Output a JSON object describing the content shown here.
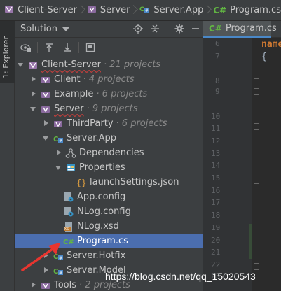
{
  "breadcrumb": [
    {
      "label": "Client-Server",
      "icon": "solution-icon"
    },
    {
      "label": "Server",
      "icon": "solution-folder-icon"
    },
    {
      "label": "Server.App",
      "icon": "project-icon"
    },
    {
      "label": "Program.cs",
      "icon": "csharp-file-icon",
      "prefix": "C#"
    }
  ],
  "side_strip": {
    "label": "1: Explorer"
  },
  "solution_header": {
    "title": "Solution"
  },
  "tree": {
    "rows": [
      {
        "label": "Client-Server",
        "sub": "· 21 projects",
        "icon": "solution-icon",
        "arrow": "down",
        "level": 0,
        "squiggle": true
      },
      {
        "label": "Client",
        "sub": "· 4 projects",
        "icon": "solution-folder-icon",
        "arrow": "right",
        "level": 1
      },
      {
        "label": "Example",
        "sub": "· 6 projects",
        "icon": "solution-folder-icon",
        "arrow": "right",
        "level": 1
      },
      {
        "label": "Server",
        "sub": "· 9 projects",
        "icon": "solution-folder-icon",
        "arrow": "down",
        "level": 1,
        "squiggle": true
      },
      {
        "label": "ThirdParty",
        "sub": "· 6 projects",
        "icon": "solution-folder-icon",
        "arrow": "right",
        "level": 2
      },
      {
        "label": "Server.App",
        "sub": "",
        "icon": "project-icon",
        "arrow": "down",
        "level": 2
      },
      {
        "label": "Dependencies",
        "sub": "",
        "icon": "dependencies-icon",
        "arrow": "right",
        "level": 3
      },
      {
        "label": "Properties",
        "sub": "",
        "icon": "properties-icon",
        "arrow": "down",
        "level": 3
      },
      {
        "label": "launchSettings.json",
        "sub": "",
        "icon": "json-file-icon",
        "arrow": "none",
        "level": 4
      },
      {
        "label": "App.config",
        "sub": "",
        "icon": "config-file-icon",
        "arrow": "none",
        "level": 3
      },
      {
        "label": "NLog.config",
        "sub": "",
        "icon": "config-file-icon",
        "arrow": "none",
        "level": 3
      },
      {
        "label": "NLog.xsd",
        "sub": "",
        "icon": "xsd-file-icon",
        "arrow": "none",
        "level": 3
      },
      {
        "label": "Program.cs",
        "sub": "",
        "icon": "csharp-file-icon",
        "arrow": "none",
        "level": 3,
        "selected": true
      },
      {
        "label": "Server.Hotfix",
        "sub": "",
        "icon": "project-icon",
        "arrow": "right",
        "level": 2
      },
      {
        "label": "Server.Model",
        "sub": "",
        "icon": "project-icon",
        "arrow": "right",
        "level": 2
      },
      {
        "label": "Tools",
        "sub": "· 2 projects",
        "icon": "solution-folder-icon",
        "arrow": "right",
        "level": 1
      }
    ]
  },
  "editor": {
    "tab": {
      "label": "Program.cs",
      "prefix": "C#"
    },
    "line_numbers": [
      "6",
      "7",
      "8",
      "9",
      "10",
      "11",
      "12",
      "13",
      "14",
      "15",
      "16",
      "17",
      "18",
      "19",
      "20",
      "21",
      "22",
      "23"
    ],
    "code_lines": [
      "name",
      "{"
    ]
  },
  "watermark": "https://blog.csdn.net/qq_15020543",
  "colors": {
    "background": "#3c3f41",
    "selection": "#4b6eaf",
    "editor_bg": "#2b2b2b",
    "csharp_green": "#62b543",
    "keyword_orange": "#cc7832",
    "annotation_arrow": "#e8352f"
  }
}
